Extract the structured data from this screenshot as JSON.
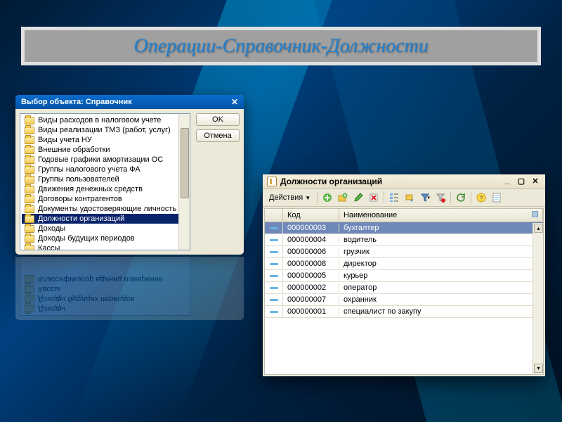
{
  "slide_title": "Операции-Справочник-Должности",
  "dialog": {
    "title": "Выбор объекта: Справочник",
    "ok_label": "OK",
    "cancel_label": "Отмена",
    "items": [
      "Виды расходов в налоговом учете",
      "Виды реализации ТМЗ (работ, услуг)",
      "Виды учета НУ",
      "Внешние обработки",
      "Годовые графики амортизации ОС",
      "Группы налогового учета ФА",
      "Группы пользователей",
      "Движения денежных средств",
      "Договоры контрагентов",
      "Документы удостоверяющие личность",
      "Должности организаций",
      "Доходы",
      "Доходы будущих периодов",
      "Кассы",
      "Классификатор единиц измерения"
    ],
    "selected_index": 10
  },
  "grid_window": {
    "title": "Должности организаций",
    "actions_label": "Действия",
    "columns": {
      "code": "Код",
      "name": "Наименование"
    },
    "rows": [
      {
        "code": "000000003",
        "name": "бухгалтер"
      },
      {
        "code": "000000004",
        "name": "водитель"
      },
      {
        "code": "000000006",
        "name": "грузчик"
      },
      {
        "code": "000000008",
        "name": "директор"
      },
      {
        "code": "000000005",
        "name": "курьер"
      },
      {
        "code": "000000002",
        "name": "оператор"
      },
      {
        "code": "000000007",
        "name": "охранник"
      },
      {
        "code": "000000001",
        "name": "специалист по закупу"
      }
    ],
    "selected_row": 0
  }
}
